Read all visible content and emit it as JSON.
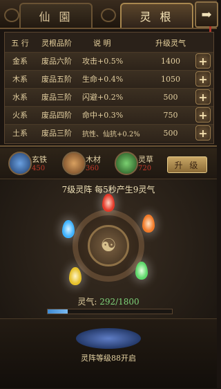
{
  "tabs": {
    "left": "仙 園",
    "active": "灵 根"
  },
  "table": {
    "headers": [
      "五 行",
      "灵根品阶",
      "说 明",
      "升级灵气"
    ],
    "rows": [
      {
        "element": "金系",
        "grade": "废品六阶",
        "desc": "攻击+0.5%",
        "cost": "1400"
      },
      {
        "element": "木系",
        "grade": "废品五阶",
        "desc": "生命+0.4%",
        "cost": "1050"
      },
      {
        "element": "水系",
        "grade": "废品三阶",
        "desc": "闪避+0.2%",
        "cost": "500"
      },
      {
        "element": "火系",
        "grade": "废品四阶",
        "desc": "命中+0.3%",
        "cost": "750"
      },
      {
        "element": "土系",
        "grade": "废品三阶",
        "desc": "抗性、仙抗+0.2%",
        "cost": "500"
      }
    ]
  },
  "resources": [
    {
      "name": "玄铁",
      "value": "450"
    },
    {
      "name": "木材",
      "value": "360"
    },
    {
      "name": "灵草",
      "value": "720"
    }
  ],
  "upgrade_label": "升 级",
  "array_title": "7级灵阵 每5秒产生9灵气",
  "qi": {
    "label": "灵气:",
    "value": "292/1800",
    "fraction": 0.162
  },
  "unlock_text": "灵阵等级88开启",
  "colors": {
    "metal": "#e23a2a",
    "wood": "#5fd86b",
    "water": "#3fb2ff",
    "fire": "#f07a2a",
    "earth": "#e6c12c"
  }
}
